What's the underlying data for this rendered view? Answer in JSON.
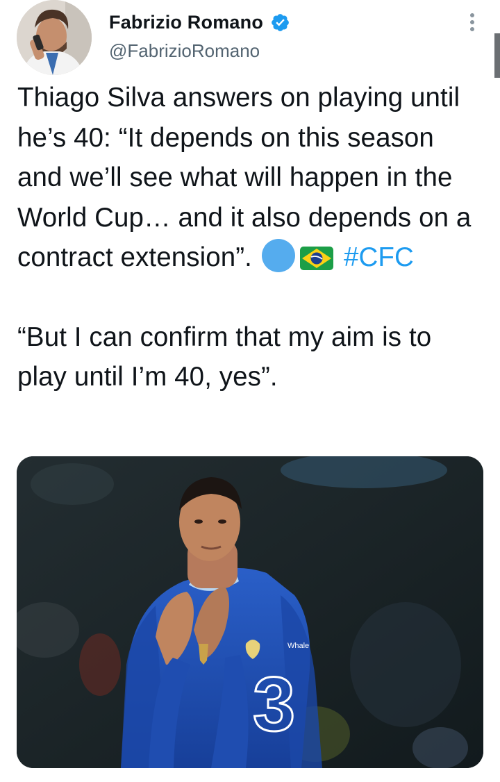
{
  "author": {
    "display_name": "Fabrizio Romano",
    "handle": "@FabrizioRomano",
    "verified": true
  },
  "tweet": {
    "paragraph_1": "Thiago Silva answers on playing until he’s 40: “It depends on this season and we’ll see what will happen in the World Cup… and it also depends on a contract extension”.",
    "hashtag": "#CFC",
    "paragraph_2": "“But I can confirm that my aim is to play until I’m 40, yes”."
  },
  "media": {
    "shirt_sponsor": "Whale",
    "shirt_number": "3"
  },
  "colors": {
    "accent": "#1d9bf0",
    "secondary_text": "#536471",
    "emoji_circle": "#55acee",
    "kit_blue": "#1a4fb5"
  },
  "icons": [
    "verified-badge-icon",
    "more-options-icon",
    "blue-circle-emoji",
    "brazil-flag-emoji"
  ]
}
